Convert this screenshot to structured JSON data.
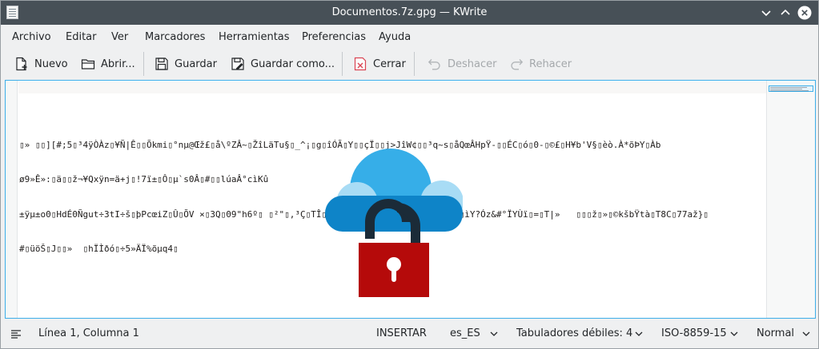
{
  "window": {
    "title": "Documentos.7z.gpg — KWrite",
    "app_icon": "text-editor-icon",
    "controls": [
      "minimize-icon",
      "maximize-icon",
      "close-icon"
    ]
  },
  "menu": {
    "items": [
      "Archivo",
      "Editar",
      "Ver",
      "Marcadores",
      "Herramientas",
      "Preferencias",
      "Ayuda"
    ]
  },
  "toolbar": {
    "new_label": "Nuevo",
    "open_label": "Abrir...",
    "save_label": "Guardar",
    "save_as_label": "Guardar como...",
    "close_label": "Cerrar",
    "undo_label": "Deshacer",
    "redo_label": "Rehacer",
    "undo_enabled": false,
    "redo_enabled": false
  },
  "editor": {
    "lines": [
      "",
      "▯» ▯▯][#;5▯³4ÿÒÀz▯¥Ñ|Ê▯▯Õkmi▯°nµ@Œž£▯å\\ºZÂ~▯ŽîLäTu§▯_^¡▯g▯îÓÃ▯Y▯▯çÏ▯▯j>JîW¢▯▯³q~s▯åQœÂHpŸ-▯▯ÉC▯ó▯0-▯©£▯H¥b'V§▯èò.À*õÞY▯Àb",
      "ø9»Ê»:▯ä▯▯ž¬¥Qxÿn=ä+j▯!7ï±▯Ô▯µ`s0Â▯#▯▯lúaÂ°cìKû",
      "±ÿµ±o0▯HdÉ0Ñgut÷3tI÷š▯þPcœiZ▯Û▯ÕV ×▯3Q▯09\"h6º▯ ▯²\"▯,³Ç▯TÎ▯▯O=}'▯€ùS▯▯»▯ú▯e¬'ÿZ▯N>Æv▯ìY?Óz&#°ÏYÙï▯=▯T|»   ▯▯▯ž▯»▯©kšbŸtà▯T8C▯77až}▯",
      "#▯üöŠ▯J▯▯»  ▯hÏÌðó▯÷5»ÄÏ%õµq4▯"
    ],
    "overlay_image": "cloud-lock-icon",
    "colors": {
      "cloud_light": "#a8dcf5",
      "cloud_mid": "#36aee8",
      "cloud_dark": "#0e84c8",
      "shackle": "#1b2b38",
      "lock_body": "#b50a0a",
      "keyhole": "#ffffff"
    }
  },
  "status": {
    "position": "Línea 1, Columna 1",
    "mode": "INSERTAR",
    "language": "es_ES",
    "indent": "Tabuladores débiles: 4",
    "encoding": "ISO-8859-15",
    "highlight": "Normal"
  },
  "theme": {
    "accent": "#3daee9",
    "titlebar": "#475057",
    "window_bg": "#eff0f1",
    "close_red": "#da4453"
  }
}
